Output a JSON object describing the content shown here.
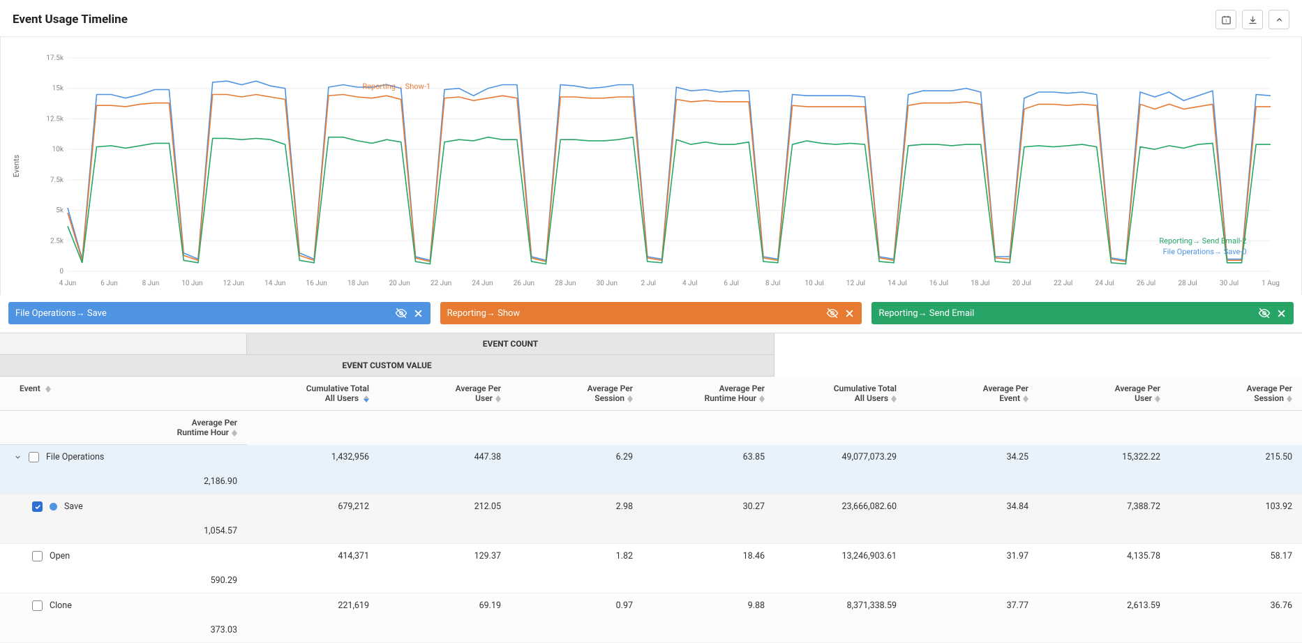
{
  "header": {
    "title": "Event Usage Timeline"
  },
  "chart_data": {
    "type": "line",
    "ylabel": "Events",
    "ylim": [
      0,
      17500
    ],
    "yticks_labels": [
      "0",
      "2.5k",
      "5k",
      "7.5k",
      "10k",
      "12.5k",
      "15k",
      "17.5k"
    ],
    "xticks_labels": [
      "4 Jun",
      "6 Jun",
      "8 Jun",
      "10 Jun",
      "12 Jun",
      "14 Jun",
      "16 Jun",
      "18 Jun",
      "20 Jun",
      "22 Jun",
      "24 Jun",
      "26 Jun",
      "28 Jun",
      "30 Jun",
      "2 Jul",
      "4 Jul",
      "6 Jul",
      "8 Jul",
      "10 Jul",
      "12 Jul",
      "14 Jul",
      "16 Jul",
      "18 Jul",
      "20 Jul",
      "22 Jul",
      "24 Jul",
      "26 Jul",
      "28 Jul",
      "30 Jul",
      "1 Aug"
    ],
    "annotations": [
      {
        "text": "Reporting→ Show-1",
        "color": "#e87b32",
        "xfrac": 0.245,
        "yfrac_top": 0.145
      },
      {
        "text": "Reporting→ Send Email-2",
        "color": "#27a567",
        "xfrac": 0.98,
        "yfrac_top": 0.87,
        "align": "end"
      },
      {
        "text": "File Operations→ Save-0",
        "color": "#4f93e3",
        "xfrac": 0.98,
        "yfrac_top": 0.92,
        "align": "end"
      }
    ],
    "series": [
      {
        "name": "File Operations→ Save",
        "color": "#4f93e3",
        "values": [
          5200,
          1000,
          14500,
          14500,
          14200,
          14500,
          14900,
          14900,
          1500,
          1000,
          15500,
          15600,
          15300,
          15600,
          15200,
          15000,
          1500,
          1000,
          15100,
          15300,
          15100,
          15100,
          15300,
          15000,
          1200,
          900,
          14900,
          15000,
          14400,
          15000,
          15300,
          15300,
          1200,
          900,
          15300,
          15200,
          15000,
          15100,
          15300,
          15300,
          1200,
          1000,
          15100,
          14800,
          14900,
          14700,
          14800,
          14800,
          1200,
          1000,
          14500,
          14400,
          14400,
          14400,
          14400,
          14300,
          1200,
          1000,
          14500,
          14800,
          14800,
          14800,
          15000,
          14700,
          1200,
          1200,
          14200,
          14700,
          14700,
          14600,
          14700,
          14500,
          1100,
          900,
          14700,
          14300,
          14700,
          14000,
          14400,
          14800,
          1000,
          1000,
          14500,
          14400
        ]
      },
      {
        "name": "Reporting→ Show",
        "color": "#e87b32",
        "values": [
          4800,
          900,
          13600,
          13600,
          13500,
          13700,
          13800,
          13800,
          1300,
          900,
          14500,
          14500,
          14300,
          14500,
          14300,
          14100,
          1300,
          900,
          14400,
          14500,
          14300,
          14200,
          14400,
          14100,
          1100,
          800,
          14200,
          14300,
          14000,
          14200,
          14400,
          14200,
          1100,
          800,
          14300,
          14300,
          14200,
          14200,
          14300,
          14300,
          1100,
          900,
          14100,
          13900,
          14000,
          13900,
          13900,
          13900,
          1100,
          900,
          13600,
          13500,
          13500,
          13500,
          13500,
          13500,
          1100,
          900,
          13600,
          13800,
          13800,
          13800,
          13900,
          13700,
          1100,
          1000,
          13300,
          13700,
          13700,
          13600,
          13700,
          13600,
          1000,
          800,
          13700,
          13300,
          13700,
          13300,
          13500,
          13700,
          900,
          900,
          13500,
          13500
        ]
      },
      {
        "name": "Reporting→ Send Email",
        "color": "#27a567",
        "values": [
          3700,
          700,
          10200,
          10300,
          10100,
          10300,
          10500,
          10500,
          900,
          700,
          10900,
          10900,
          10800,
          10900,
          10800,
          10400,
          900,
          700,
          11000,
          11000,
          10700,
          10500,
          10800,
          10600,
          800,
          600,
          10600,
          10800,
          10700,
          11000,
          10800,
          10800,
          800,
          600,
          10800,
          10800,
          10700,
          10700,
          10800,
          11000,
          800,
          700,
          10800,
          10400,
          10600,
          10400,
          10400,
          10600,
          800,
          700,
          10400,
          10700,
          10500,
          10400,
          10500,
          10400,
          800,
          700,
          10300,
          10400,
          10400,
          10300,
          10400,
          10400,
          800,
          700,
          10200,
          10300,
          10200,
          10300,
          10400,
          10200,
          700,
          600,
          10200,
          10000,
          10300,
          10100,
          10400,
          10500,
          700,
          700,
          10400,
          10400
        ]
      }
    ]
  },
  "chips": [
    {
      "label": "File Operations→ Save",
      "color": "#4f93e3"
    },
    {
      "label": "Reporting→ Show",
      "color": "#e87b32"
    },
    {
      "label": "Reporting→ Send Email",
      "color": "#27a567"
    }
  ],
  "table": {
    "group_headers": {
      "g1": "EVENT COUNT",
      "g2": "EVENT CUSTOM VALUE"
    },
    "col_headers": {
      "event": "Event",
      "c1": "Cumulative Total\nAll Users",
      "c2": "Average Per\nUser",
      "c3": "Average Per\nSession",
      "c4": "Average Per\nRuntime Hour",
      "c5": "Cumulative Total\nAll Users",
      "c6": "Average Per\nEvent",
      "c7": "Average Per\nUser",
      "c8": "Average Per\nSession",
      "c9": "Average Per\nRuntime Hour"
    },
    "rows": [
      {
        "label": "File Operations",
        "parent": true,
        "v": [
          "1,432,956",
          "447.38",
          "6.29",
          "63.85",
          "49,077,073.29",
          "34.25",
          "15,322.22",
          "215.50",
          "2,186.90"
        ]
      },
      {
        "label": "Save",
        "checked": true,
        "dot": true,
        "v": [
          "679,212",
          "212.05",
          "2.98",
          "30.27",
          "23,666,082.60",
          "34.84",
          "7,388.72",
          "103.92",
          "1,054.57"
        ]
      },
      {
        "label": "Open",
        "v": [
          "414,371",
          "129.37",
          "1.82",
          "18.46",
          "13,246,903.61",
          "31.97",
          "4,135.78",
          "58.17",
          "590.29"
        ]
      },
      {
        "label": "Clone",
        "v": [
          "221,619",
          "69.19",
          "0.97",
          "9.88",
          "8,371,338.59",
          "37.77",
          "2,613.59",
          "36.76",
          "373.03"
        ]
      }
    ]
  }
}
